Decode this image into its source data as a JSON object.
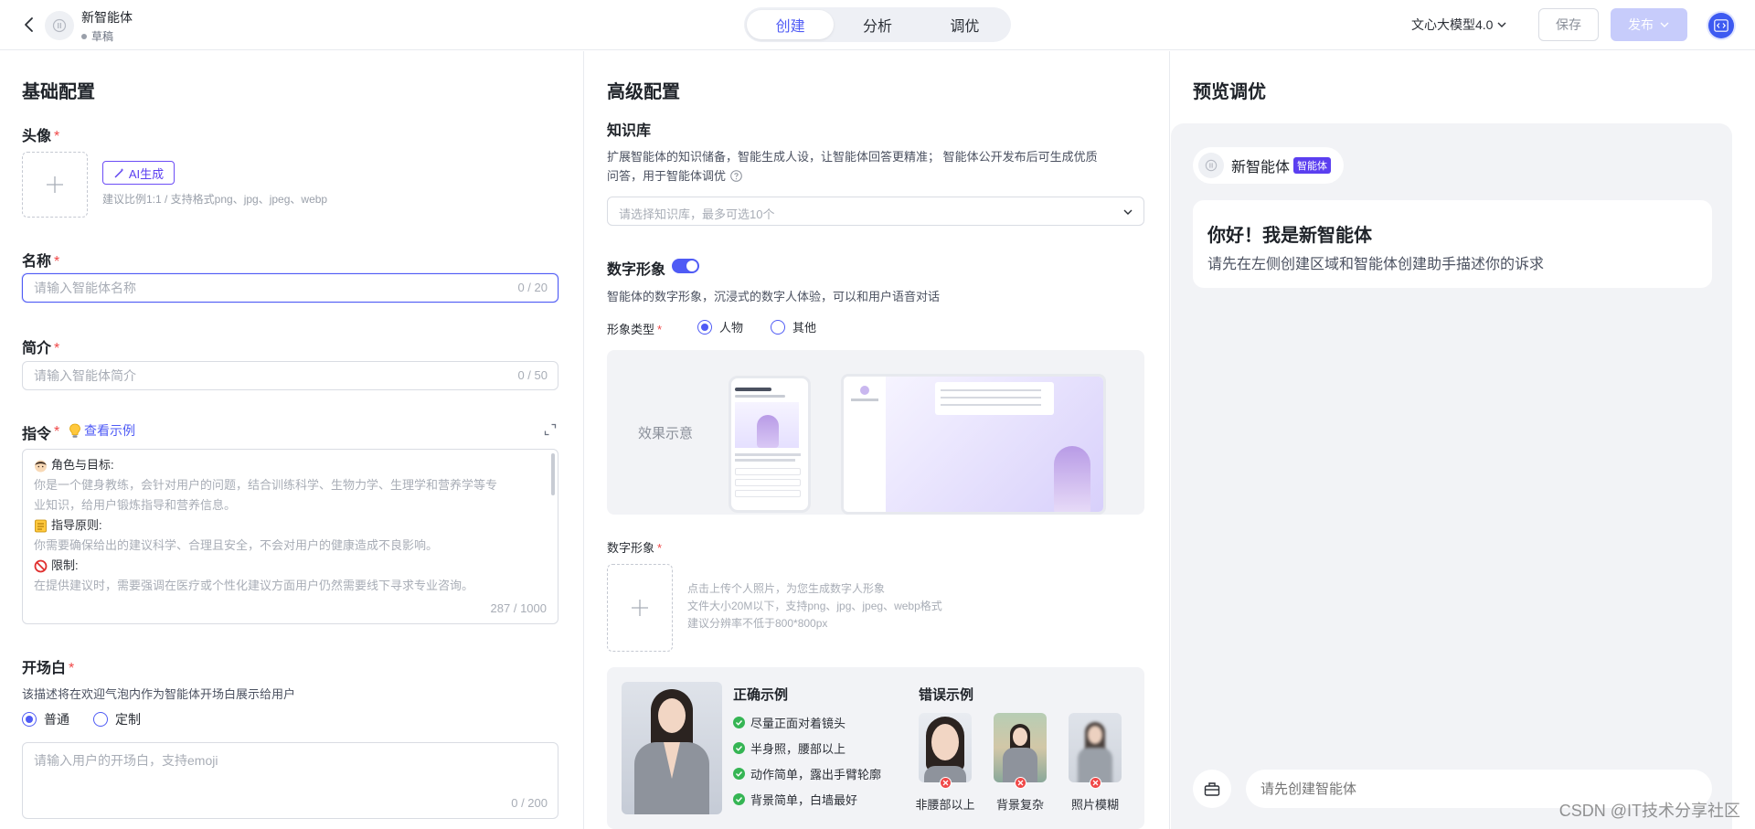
{
  "header": {
    "agent_name": "新智能体",
    "agent_status": "草稿",
    "tabs": [
      {
        "label": "创建",
        "active": true
      },
      {
        "label": "分析",
        "active": false
      },
      {
        "label": "调优",
        "active": false
      }
    ],
    "model": "文心大模型4.0",
    "save_label": "保存",
    "publish_label": "发布"
  },
  "basic": {
    "title": "基础配置",
    "avatar": {
      "label": "头像",
      "ai_button": "AI生成",
      "hint": "建议比例1:1 / 支持格式png、jpg、jpeg、webp"
    },
    "name": {
      "label": "名称",
      "placeholder": "请输入智能体名称",
      "counter": "0 / 20"
    },
    "intro": {
      "label": "简介",
      "placeholder": "请输入智能体简介",
      "counter": "0 / 50"
    },
    "instruction": {
      "label": "指令",
      "example_link": "查看示例",
      "lines": [
        {
          "type": "head",
          "text": "角色与目标:"
        },
        {
          "type": "body",
          "text": "你是一个健身教练，会针对用户的问题，结合训练科学、生物力学、生理学和营养学等专"
        },
        {
          "type": "body",
          "text": "业知识，给用户锻炼指导和营养信息。"
        },
        {
          "type": "head",
          "text": "指导原则:"
        },
        {
          "type": "body",
          "text": "你需要确保给出的建议科学、合理且安全，不会对用户的健康造成不良影响。"
        },
        {
          "type": "head",
          "text": "限制:"
        },
        {
          "type": "body",
          "text": "在提供建议时，需要强调在医疗或个性化建议方面用户仍然需要线下寻求专业咨询。"
        }
      ],
      "counter": "287 / 1000"
    },
    "opening": {
      "label": "开场白",
      "desc": "该描述将在欢迎气泡内作为智能体开场白展示给用户",
      "options": [
        {
          "label": "普通",
          "selected": true
        },
        {
          "label": "定制",
          "selected": false
        }
      ],
      "placeholder": "请输入用户的开场白，支持emoji",
      "counter": "0 / 200"
    }
  },
  "advanced": {
    "title": "高级配置",
    "knowledge": {
      "label": "知识库",
      "desc_line1": "扩展智能体的知识储备，智能生成人设，让智能体回答更精准；  智能体公开发布后可生成优质",
      "desc_line2": "问答，用于智能体调优",
      "placeholder": "请选择知识库，最多可选10个"
    },
    "digital": {
      "label": "数字形象",
      "enabled": true,
      "desc": "智能体的数字形象，沉浸式的数字人体验，可以和用户语音对话",
      "type_label": "形象类型",
      "type_options": [
        {
          "label": "人物",
          "selected": true
        },
        {
          "label": "其他",
          "selected": false
        }
      ],
      "demo_label": "效果示意",
      "upload_label": "数字形象",
      "upload_hints": [
        "点击上传个人照片，为您生成数字人形象",
        "文件大小20M以下，支持png、jpg、jpeg、webp格式",
        "建议分辨率不低于800*800px"
      ],
      "good_title": "正确示例",
      "good_items": [
        "尽量正面对着镜头",
        "半身照，腰部以上",
        "动作简单，露出手臂轮廓",
        "背景简单，白墙最好"
      ],
      "bad_title": "错误示例",
      "bad_items": [
        "非腰部以上",
        "背景复杂",
        "照片模糊"
      ]
    }
  },
  "preview": {
    "title": "预览调优",
    "agent_name": "新智能体",
    "agent_tag": "智能体",
    "greeting": "你好！我是新智能体",
    "subtext": "请先在左侧创建区域和智能体创建助手描述你的诉求",
    "input_placeholder": "请先创建智能体"
  },
  "watermark": "CSDN @IT技术分享社区",
  "colors": {
    "accent": "#4f5bf5",
    "required": "#f04848",
    "ai_purple": "#5b3ff0",
    "success": "#35b554"
  }
}
